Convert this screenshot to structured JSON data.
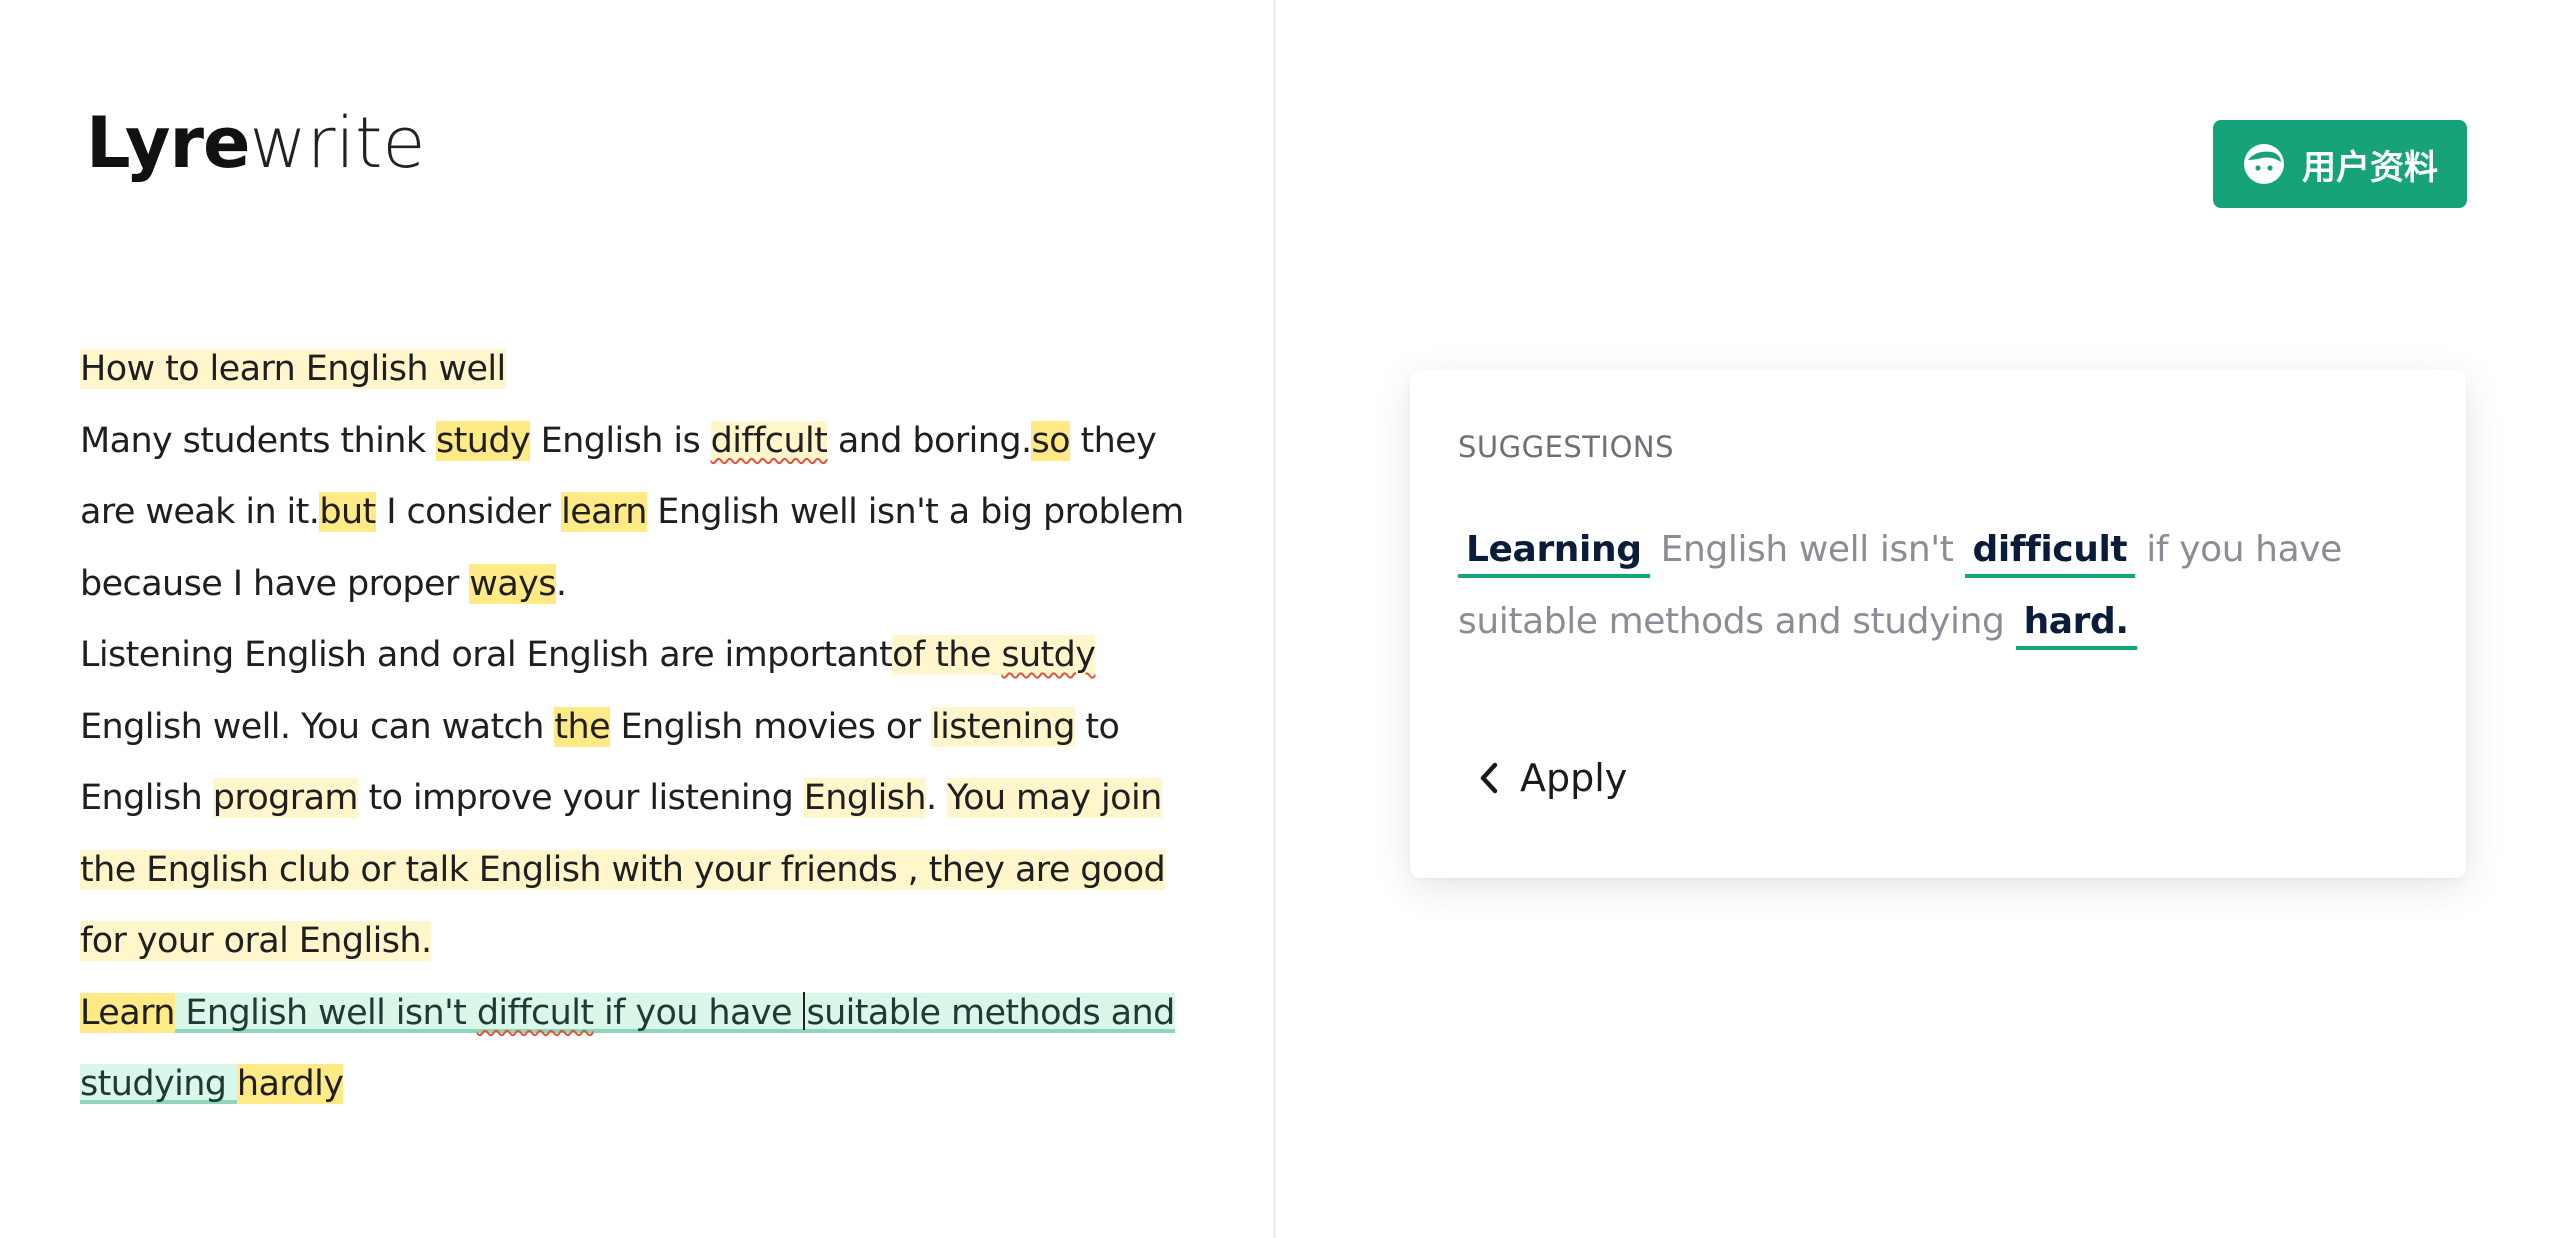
{
  "app": {
    "logo_strong": "Lyre",
    "logo_light": "write"
  },
  "essay": {
    "title": "How to learn English well",
    "p1": {
      "t1": "Many students think ",
      "w_study": "study",
      "t2": " English is ",
      "w_diffcult": "diffcult",
      "t3": " and boring.",
      "w_so": "so",
      "t4": " they are weak in it.",
      "w_but": "but",
      "t5": " I consider ",
      "w_learn": "learn",
      "t6": " English well isn't a big problem because I have proper ",
      "w_ways": "ways",
      "t7": "."
    },
    "p2": {
      "t1": "Listening English and oral English are important",
      "w_ofthe": "of the ",
      "w_sutdy": "sutdy",
      "t2": " English well. You can watch ",
      "w_the": "the",
      "t3": " English movies or ",
      "w_listening": "listening",
      "t4": " to English ",
      "w_program": "program",
      "t5": " to improve your listening ",
      "w_english": "English",
      "t6": ". ",
      "w_join": "You may join the English club or talk English with your friends , they are good for your oral English."
    },
    "p3": {
      "w_learn": "Learn",
      "t1": " English well isn't ",
      "w_diffcult": "diffcult",
      "t2": " if you have",
      "t3": "suitable methods and studying ",
      "w_hardly": "hardly"
    }
  },
  "profile_button": {
    "label": "用户资料",
    "icon": "user-face-icon"
  },
  "suggestions": {
    "title": "SUGGESTIONS",
    "w_learning": "Learning",
    "t1": " English well isn't ",
    "w_difficult": "difficult",
    "t2": " if you have suitable methods and studying ",
    "w_hard": "hard.",
    "apply_label": "Apply"
  },
  "colors": {
    "accent": "#17a37a",
    "highlight_light": "#fff6cc",
    "highlight_strong": "#ffea86",
    "selected_sentence": "#d9f8ea"
  }
}
